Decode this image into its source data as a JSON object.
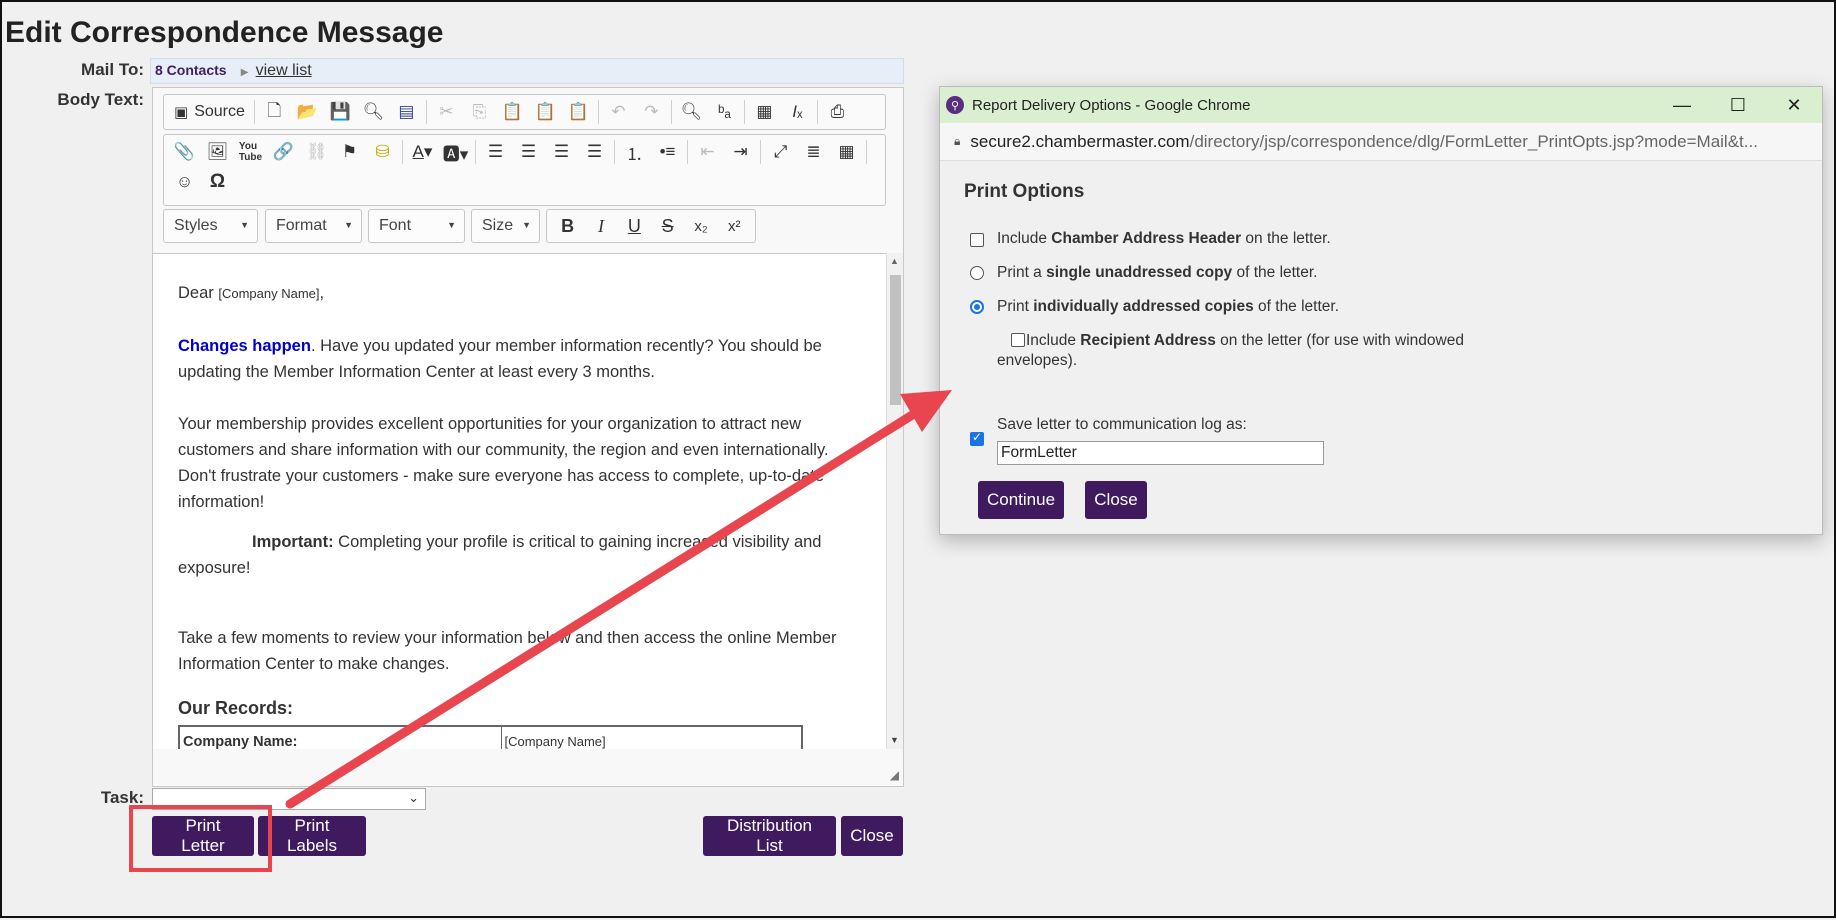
{
  "page": {
    "title": "Edit Correspondence Message"
  },
  "form": {
    "mail_to_label": "Mail To:",
    "contacts": "8 Contacts",
    "view_list": "view list",
    "body_text_label": "Body Text:",
    "task_label": "Task:",
    "task_value": ""
  },
  "toolbar": {
    "source_label": "Source",
    "styles": "Styles",
    "format": "Format",
    "font": "Font",
    "size": "Size"
  },
  "letter": {
    "greeting": "Dear ",
    "company_placeholder": "[Company Name]",
    "greeting_end": ",",
    "p1_lead": "Changes happen",
    "p1_rest": ". Have you updated your member information recently? You should be updating the Member Information Center at least every 3 months.",
    "p2": "Your membership provides excellent opportunities for your organization to attract new customers and share information with our community, the region and even internationally. Don't frustrate your customers - make sure everyone has access to complete, up-to-date information!",
    "p3_lead": "Important:",
    "p3_rest": " Completing your profile is critical to gaining increased visibility and exposure!",
    "p4": "Take a few moments to review your information below and then access the online Member Information Center to make changes.",
    "records_heading": "Our Records:",
    "records_row_label": "Company Name:",
    "records_row_value": "[Company Name]"
  },
  "buttons": {
    "print_letter": "Print Letter",
    "print_labels": "Print Labels",
    "distribution_list": "Distribution List",
    "close": "Close"
  },
  "popup": {
    "window_title": "Report Delivery Options - Google Chrome",
    "url_domain": "secure2.chambermaster.com",
    "url_path": "/directory/jsp/correspondence/dlg/FormLetter_PrintOpts.jsp?mode=Mail&t...",
    "heading": "Print Options",
    "opt1_pre": "Include ",
    "opt1_bold": "Chamber Address Header",
    "opt1_post": " on the letter.",
    "opt2_pre": "Print a ",
    "opt2_bold": "single unaddressed copy",
    "opt2_post": " of the letter.",
    "opt3_pre": "Print ",
    "opt3_bold": "individually addressed copies",
    "opt3_post": " of the letter.",
    "opt4_pre": "Include ",
    "opt4_bold": "Recipient Address",
    "opt4_post": " on the letter (for use with windowed envelopes).",
    "save_log_label": "Save letter to communication log as:",
    "save_log_value": "FormLetter",
    "continue": "Continue",
    "close": "Close"
  },
  "colors": {
    "button_purple": "#3f1a5e",
    "annotation_red": "#e8454f",
    "titlebar_green": "#d9efd0"
  }
}
